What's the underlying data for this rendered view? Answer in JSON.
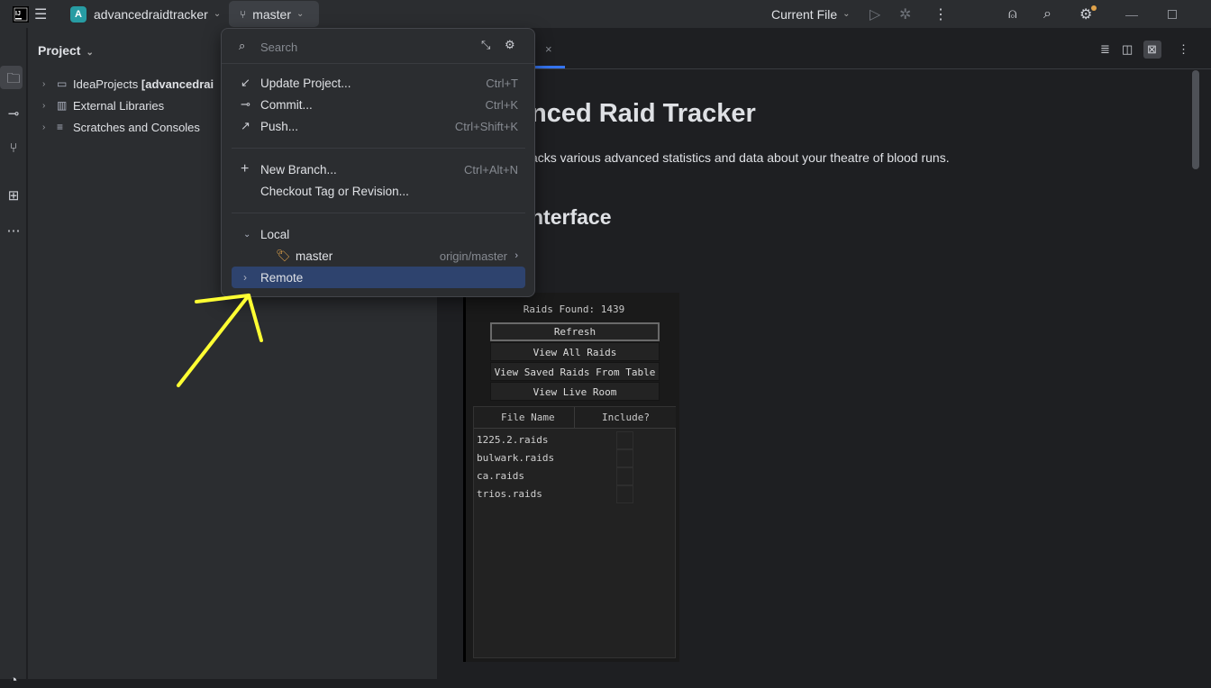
{
  "titlebar": {
    "project_badge": "A",
    "project_name": "advancedraidtracker",
    "branch": "master",
    "run_config": "Current File"
  },
  "project_panel": {
    "title": "Project",
    "tree": [
      {
        "label": "IdeaProjects",
        "suffix": "[advancedrai",
        "icon": "folder-icon"
      },
      {
        "label": "External Libraries",
        "suffix": "",
        "icon": "library-icon"
      },
      {
        "label": "Scratches and Consoles",
        "suffix": "",
        "icon": "scratches-icon"
      }
    ]
  },
  "popup": {
    "search_placeholder": "Search",
    "actions": [
      {
        "label": "Update Project...",
        "shortcut": "Ctrl+T",
        "icon": "update-icon"
      },
      {
        "label": "Commit...",
        "shortcut": "Ctrl+K",
        "icon": "commit-icon"
      },
      {
        "label": "Push...",
        "shortcut": "Ctrl+Shift+K",
        "icon": "push-icon"
      }
    ],
    "branch_actions": [
      {
        "label": "New Branch...",
        "shortcut": "Ctrl+Alt+N",
        "icon": "plus-icon"
      },
      {
        "label": "Checkout Tag or Revision...",
        "shortcut": "",
        "icon": ""
      }
    ],
    "local_label": "Local",
    "local_branch": "master",
    "local_branch_tracking": "origin/master",
    "remote_label": "Remote"
  },
  "editor": {
    "heading1": "nced Raid Tracker",
    "description": "acks various advanced statistics and data about your theatre of blood runs.",
    "heading2": "nterface",
    "plugin": {
      "raids_found": "Raids Found: 1439",
      "buttons": [
        "Refresh",
        "View All Raids",
        "View Saved Raids From Table",
        "View Live Room"
      ],
      "columns": [
        "File Name",
        "Include?"
      ],
      "files": [
        "1225.2.raids",
        "bulwark.raids",
        "ca.raids",
        "trios.raids"
      ]
    }
  },
  "colors": {
    "accent": "#3574f0",
    "highlight": "#2e436e",
    "annotation": "#ffff33"
  }
}
